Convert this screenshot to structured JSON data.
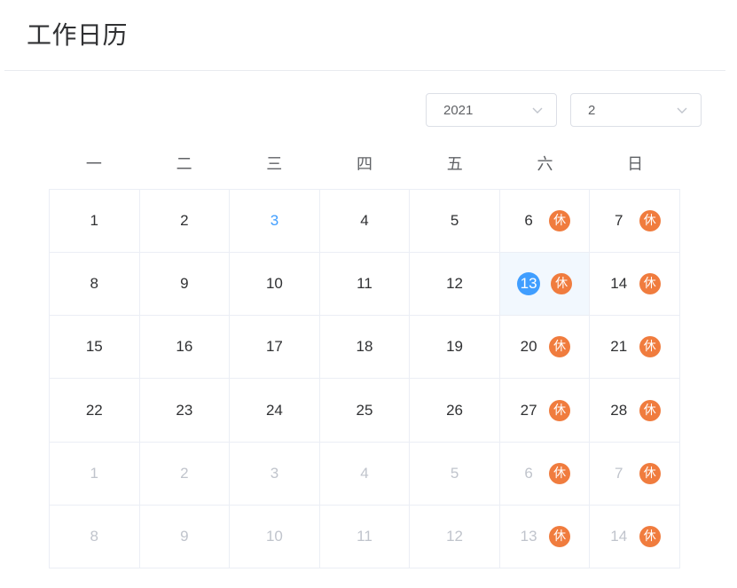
{
  "page": {
    "title": "工作日历"
  },
  "controls": {
    "year": "2021",
    "month": "2"
  },
  "weekdays": [
    "一",
    "二",
    "三",
    "四",
    "五",
    "六",
    "日"
  ],
  "rest_badge": "休",
  "colors": {
    "accent": "#409eff",
    "rest_badge": "#f07c3e",
    "muted_text": "#c0c4cc",
    "selected_bg": "#f2f8fe"
  },
  "weeks": [
    [
      {
        "day": "1",
        "other": false
      },
      {
        "day": "2",
        "other": false
      },
      {
        "day": "3",
        "other": false,
        "today": true
      },
      {
        "day": "4",
        "other": false
      },
      {
        "day": "5",
        "other": false
      },
      {
        "day": "6",
        "other": false,
        "rest": true
      },
      {
        "day": "7",
        "other": false,
        "rest": true
      }
    ],
    [
      {
        "day": "8",
        "other": false
      },
      {
        "day": "9",
        "other": false
      },
      {
        "day": "10",
        "other": false
      },
      {
        "day": "11",
        "other": false
      },
      {
        "day": "12",
        "other": false
      },
      {
        "day": "13",
        "other": false,
        "rest": true,
        "selected": true
      },
      {
        "day": "14",
        "other": false,
        "rest": true
      }
    ],
    [
      {
        "day": "15",
        "other": false
      },
      {
        "day": "16",
        "other": false
      },
      {
        "day": "17",
        "other": false
      },
      {
        "day": "18",
        "other": false
      },
      {
        "day": "19",
        "other": false
      },
      {
        "day": "20",
        "other": false,
        "rest": true
      },
      {
        "day": "21",
        "other": false,
        "rest": true
      }
    ],
    [
      {
        "day": "22",
        "other": false
      },
      {
        "day": "23",
        "other": false
      },
      {
        "day": "24",
        "other": false
      },
      {
        "day": "25",
        "other": false
      },
      {
        "day": "26",
        "other": false
      },
      {
        "day": "27",
        "other": false,
        "rest": true
      },
      {
        "day": "28",
        "other": false,
        "rest": true
      }
    ],
    [
      {
        "day": "1",
        "other": true
      },
      {
        "day": "2",
        "other": true
      },
      {
        "day": "3",
        "other": true
      },
      {
        "day": "4",
        "other": true
      },
      {
        "day": "5",
        "other": true
      },
      {
        "day": "6",
        "other": true,
        "rest": true
      },
      {
        "day": "7",
        "other": true,
        "rest": true
      }
    ],
    [
      {
        "day": "8",
        "other": true
      },
      {
        "day": "9",
        "other": true
      },
      {
        "day": "10",
        "other": true
      },
      {
        "day": "11",
        "other": true
      },
      {
        "day": "12",
        "other": true
      },
      {
        "day": "13",
        "other": true,
        "rest": true
      },
      {
        "day": "14",
        "other": true,
        "rest": true
      }
    ]
  ]
}
